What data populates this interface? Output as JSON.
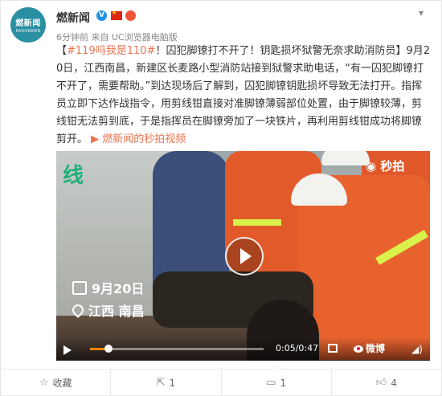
{
  "author": {
    "avatar_text": "燃新闻",
    "avatar_sub": "RANXINWEN",
    "name": "燃新闻",
    "verified_mark": "V",
    "badge_text": "₯"
  },
  "meta": {
    "time_source": "6分钟前 来自 UC浏览器电脑版"
  },
  "post": {
    "hashtag": "#119吗我是110#",
    "text": "！囚犯脚镣打不开了！钥匙损坏狱警无奈求助消防员】9月20日，江西南昌，新建区长麦路小型消防站接到狱警求助电话，“有一囚犯脚镣打不开了，需要帮助。”到达现场后了解到，囚犯脚镣钥匙损坏导致无法打开。指挥员立即下达作战指令，用剪线钳直接对准脚镣薄弱部位处置，由于脚镣较薄，剪线钳无法剪到底，于是指挥员在脚镣旁加了一块铁片，再利用剪线钳成功将脚镣剪开。",
    "open_bracket": "【",
    "video_link": "燃新闻的秒拍视频"
  },
  "video": {
    "overlay_top_left": "线",
    "watermark": "秒拍",
    "date": "9月20日",
    "location": "江西 南昌",
    "time": "0:05/0:47",
    "progress": 0.106,
    "logo": "微博",
    "brand_color": "#ff8200"
  },
  "footer": {
    "favorite_label": "收藏",
    "repost_count": "1",
    "comment_count": "1",
    "like_count": "4"
  },
  "icons": {
    "chevron": "chevron-down-icon",
    "favorite": "star-icon",
    "repost": "share-icon",
    "comment": "comment-icon",
    "like": "thumbs-up-icon"
  }
}
